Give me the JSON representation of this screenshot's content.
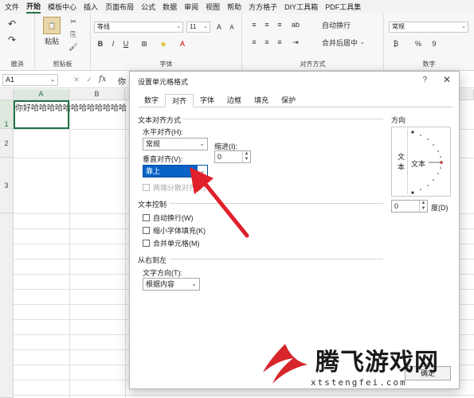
{
  "menubar": {
    "items": [
      "文件",
      "开始",
      "模板中心",
      "插入",
      "页面布局",
      "公式",
      "数据",
      "审阅",
      "视图",
      "帮助",
      "方方格子",
      "DIY工具箱",
      "PDF工具集"
    ],
    "active_index": 1
  },
  "ribbon": {
    "undo_group_label": "撤消",
    "clipboard_group_label": "剪贴板",
    "paste_label": "粘贴",
    "font_group_label": "字体",
    "font_name": "等线",
    "font_size": "11",
    "bold": "B",
    "italic": "I",
    "underline": "U",
    "align_group_label": "对齐方式",
    "wrap_text": "自动换行",
    "merge_center": "合并后居中",
    "number_group_label": "数字",
    "number_format": "常规",
    "percent": "%",
    "comma": "9"
  },
  "formula_bar": {
    "cell_ref": "A1",
    "fx": "fx",
    "content": "你"
  },
  "sheet": {
    "columns": [
      "A",
      "B"
    ],
    "rows": [
      "1",
      "2",
      "3"
    ],
    "a1_text": "你好哈哈哈哈哈哈哈哈哈哈哈哈"
  },
  "dialog": {
    "title": "设置单元格格式",
    "help": "?",
    "close": "✕",
    "tabs": [
      "数字",
      "对齐",
      "字体",
      "边框",
      "填充",
      "保护"
    ],
    "active_tab_index": 1,
    "text_alignment_section": "文本对齐方式",
    "horizontal_label": "水平对齐(H):",
    "horizontal_value": "常规",
    "indent_label": "缩进(I):",
    "indent_value": "0",
    "vertical_label": "垂直对齐(V):",
    "vertical_value": "靠上",
    "justify_distributed": "两端分散对齐(E)",
    "text_control_section": "文本控制",
    "wrap_text": "自动换行(W)",
    "shrink_to_fit": "缩小字体填充(K)",
    "merge_cells": "合并单元格(M)",
    "rtl_section": "从右到左",
    "text_direction_label": "文字方向(T):",
    "text_direction_value": "根据内容",
    "orientation_section": "方向",
    "orientation_vertical_text": "文本",
    "orientation_dial_text": "文本",
    "degree_value": "0",
    "degree_label": "度(D)",
    "ok_label": "确定"
  },
  "watermark": {
    "text": "腾飞游戏网",
    "url": "xtstengfei.com"
  },
  "colors": {
    "excel_green": "#217346",
    "highlight_blue": "#0a64c8",
    "arrow_red": "#e0202a"
  }
}
